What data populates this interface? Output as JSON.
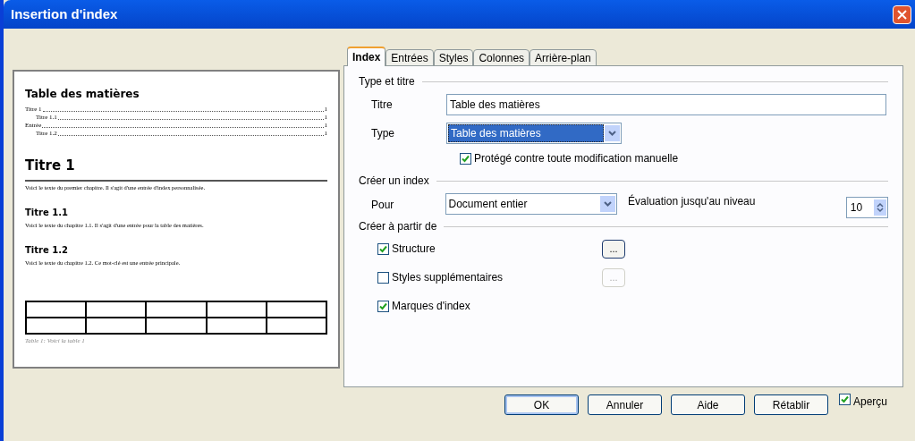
{
  "window": {
    "title": "Insertion d'index"
  },
  "preview": {
    "toc_title": "Table des matières",
    "toc_entries": [
      {
        "label": "Titre 1",
        "page": "1",
        "children": [
          {
            "label": "Titre 1.1",
            "page": "1"
          }
        ]
      },
      {
        "label": "Entrée",
        "page": "1",
        "children": [
          {
            "label": "Titre 1.2",
            "page": "1"
          }
        ]
      }
    ],
    "sections": [
      {
        "kind": "h1",
        "heading": "Titre 1",
        "text": "Voici le texte du premier chapitre. Il s'agit d'une entrée d'index personnalisée."
      },
      {
        "kind": "h2",
        "heading": "Titre 1.1",
        "text": "Voici le texte du chapitre 1.1. Il s'agit d'une entrée pour la table des matières."
      },
      {
        "kind": "h2",
        "heading": "Titre 1.2",
        "text": "Voici le texte du chapitre 1.2. Ce mot-clé est une entrée principale."
      }
    ],
    "table_caption": "Table 1: Voici la table 1"
  },
  "tabs": [
    {
      "label": "Index",
      "selected": true
    },
    {
      "label": "Entrées",
      "selected": false
    },
    {
      "label": "Styles",
      "selected": false
    },
    {
      "label": "Colonnes",
      "selected": false
    },
    {
      "label": "Arrière-plan",
      "selected": false
    }
  ],
  "type_and_title": {
    "heading": "Type et titre",
    "title_label": "Titre",
    "title_value": "Table des matières",
    "type_label": "Type",
    "type_value": "Table des matières",
    "protected": {
      "label": "Protégé contre toute modification manuelle",
      "checked": true
    }
  },
  "create_index": {
    "heading": "Créer un index",
    "for_label": "Pour",
    "for_value": "Document entier",
    "level_label": "Évaluation jusqu'au niveau",
    "level_value": "10"
  },
  "create_from": {
    "heading": "Créer à partir de",
    "options": [
      {
        "label": "Structure",
        "checked": true,
        "button": "...",
        "button_disabled": false
      },
      {
        "label": "Styles supplémentaires",
        "checked": false,
        "button": "...",
        "button_disabled": true
      },
      {
        "label": "Marques d'index",
        "checked": true
      }
    ]
  },
  "buttons": [
    {
      "label": "OK",
      "default": true
    },
    {
      "label": "Annuler",
      "default": false
    },
    {
      "label": "Aide",
      "default": false
    },
    {
      "label": "Rétablir",
      "default": false
    }
  ],
  "preview_toggle": {
    "label": "Aperçu",
    "checked": true
  }
}
